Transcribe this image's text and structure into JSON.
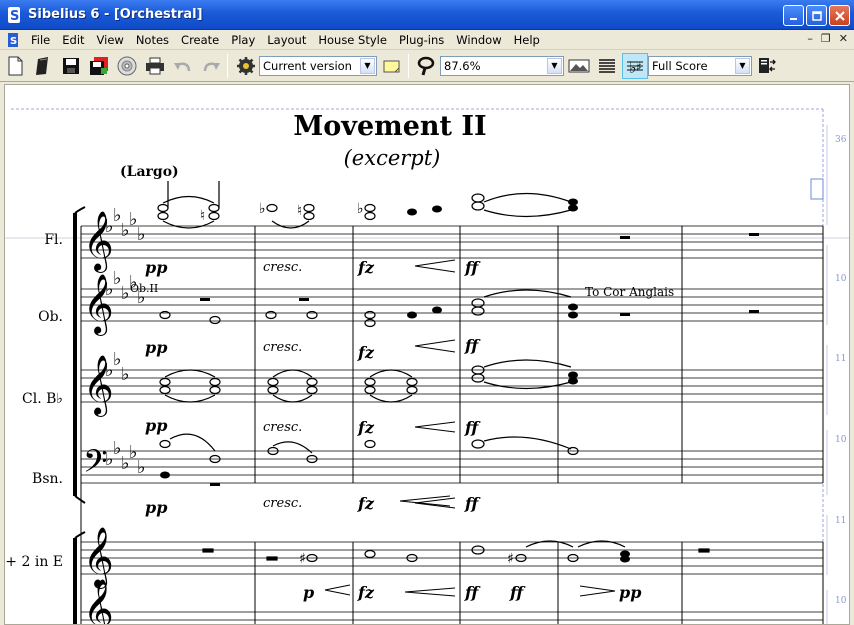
{
  "window": {
    "title": "Sibelius 6 - [Orchestral]"
  },
  "menu": {
    "items": [
      "File",
      "Edit",
      "View",
      "Notes",
      "Create",
      "Play",
      "Layout",
      "House Style",
      "Plug-ins",
      "Window",
      "Help"
    ]
  },
  "toolbar": {
    "version_select": "Current version",
    "zoom_select": "87.6%",
    "view_select": "Full Score"
  },
  "score": {
    "title": "Movement II",
    "subtitle": "(excerpt)",
    "tempo": "(Largo)",
    "instruments": [
      "Fl.",
      "Ob.",
      "Cl. B♭",
      "Bsn.",
      "+ 2 in E"
    ],
    "dynamics": {
      "pp": "pp",
      "cresc": "cresc.",
      "fz": "fz",
      "ff": "ff",
      "p": "p"
    },
    "ob_label": "Ob.II",
    "cor_anglais": "To Cor Anglais",
    "bar_numbers": [
      "36",
      "10",
      "11",
      "10",
      "11",
      "10"
    ]
  }
}
